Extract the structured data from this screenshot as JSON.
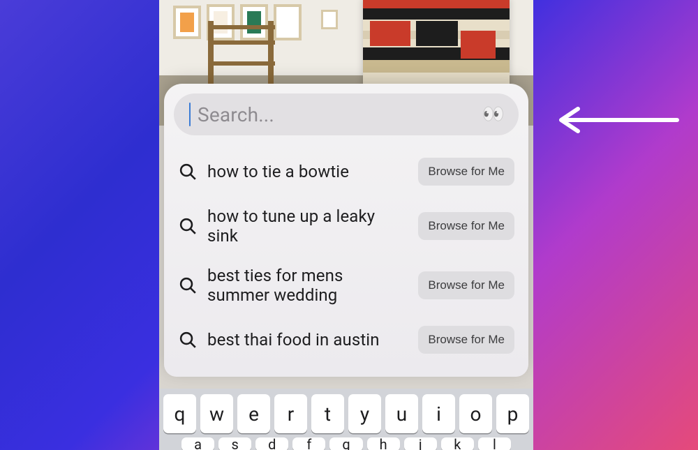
{
  "search": {
    "placeholder": "Search...",
    "eyes_icon": "👀"
  },
  "suggestions": [
    {
      "text": "how to tie a bowtie",
      "button": "Browse for Me"
    },
    {
      "text": "how to tune up a leaky sink",
      "button": "Browse for Me"
    },
    {
      "text": "best ties for mens summer wedding",
      "button": "Browse for Me"
    },
    {
      "text": "best thai food in austin",
      "button": "Browse for Me"
    }
  ],
  "keyboard": {
    "row1": [
      "q",
      "w",
      "e",
      "r",
      "t",
      "y",
      "u",
      "i",
      "o",
      "p"
    ],
    "row2": [
      "a",
      "s",
      "d",
      "f",
      "g",
      "h",
      "j",
      "k",
      "l"
    ]
  }
}
